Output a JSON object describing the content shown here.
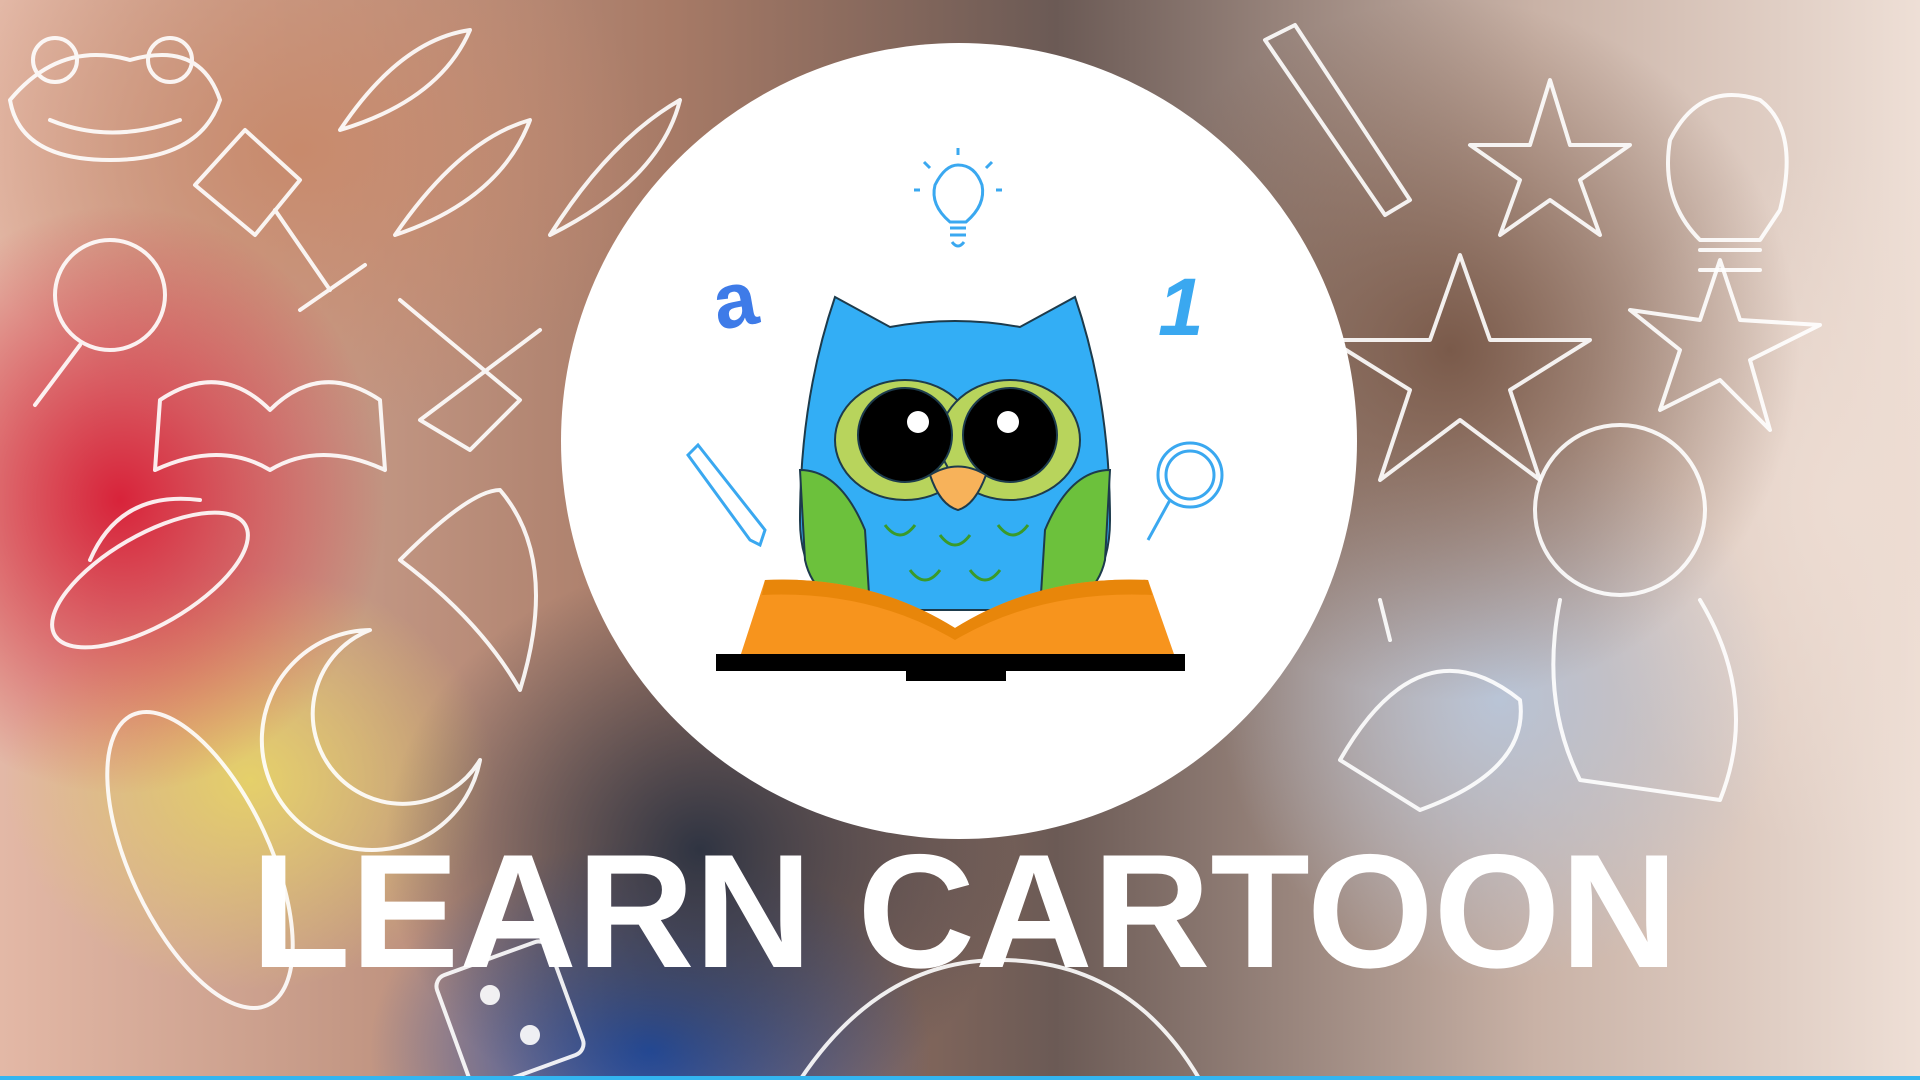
{
  "title": "LEARN CARTOON",
  "logo": {
    "letter": "a",
    "number": "1"
  },
  "colors": {
    "owl_blue": "#33aef5",
    "owl_green": "#6cc13c",
    "eye_ring": "#b8d45c",
    "beak": "#f7b25a",
    "book_orange": "#f7941d",
    "icon_blue": "#3aa8f0",
    "accent_line": "#33b5f0"
  }
}
